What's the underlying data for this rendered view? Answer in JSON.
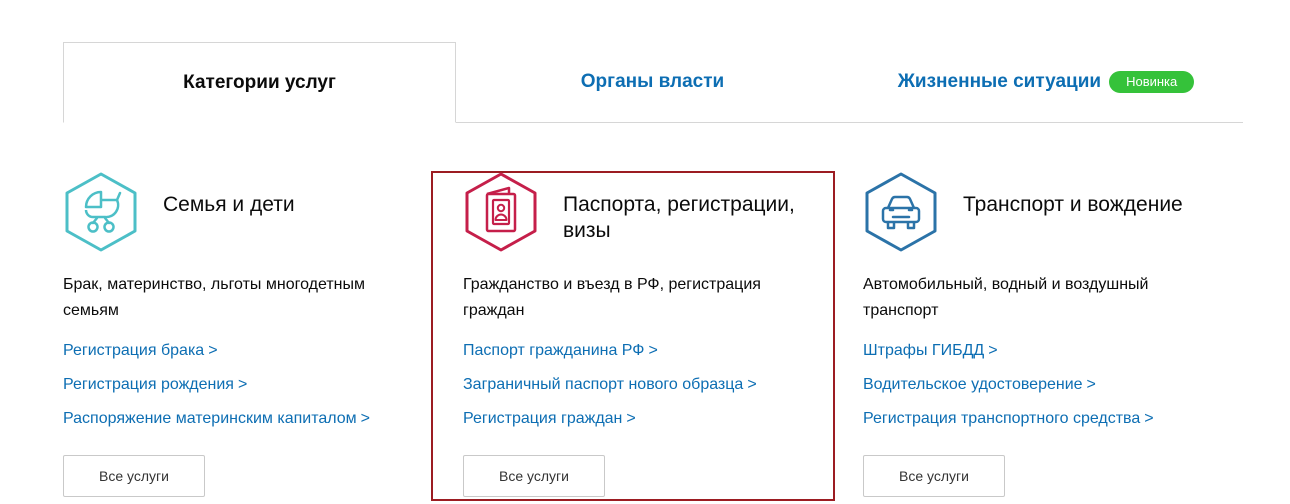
{
  "tabs": [
    {
      "label": "Категории услуг",
      "active": true
    },
    {
      "label": "Органы власти",
      "active": false
    },
    {
      "label": "Жизненные ситуации",
      "active": false,
      "badge": "Новинка"
    }
  ],
  "colors": {
    "link": "#0d6eb3",
    "badge": "#35c23a",
    "highlight": "#9c1c22",
    "icon_family": "#4cbfc7",
    "icon_passport": "#c51f4a",
    "icon_transport": "#2b73a8"
  },
  "cards": [
    {
      "icon": "stroller-icon",
      "title": "Семья и дети",
      "description": "Брак, материнство, льготы многодетным семьям",
      "links": [
        "Регистрация брака",
        "Регистрация рождения",
        "Распоряжение материнским капиталом"
      ],
      "button": "Все услуги"
    },
    {
      "icon": "passport-icon",
      "title": "Паспорта, регистрации, визы",
      "description": "Гражданство и въезд в РФ, регистрация граждан",
      "links": [
        "Паспорт гражданина РФ",
        "Заграничный паспорт нового образца",
        "Регистрация граждан"
      ],
      "button": "Все услуги"
    },
    {
      "icon": "car-icon",
      "title": "Транспорт и вождение",
      "description": "Автомобильный, водный и воздушный транспорт",
      "links": [
        "Штрафы ГИБДД",
        "Водительское удостоверение",
        "Регистрация транспортного средства"
      ],
      "button": "Все услуги"
    }
  ],
  "chevron": ">"
}
